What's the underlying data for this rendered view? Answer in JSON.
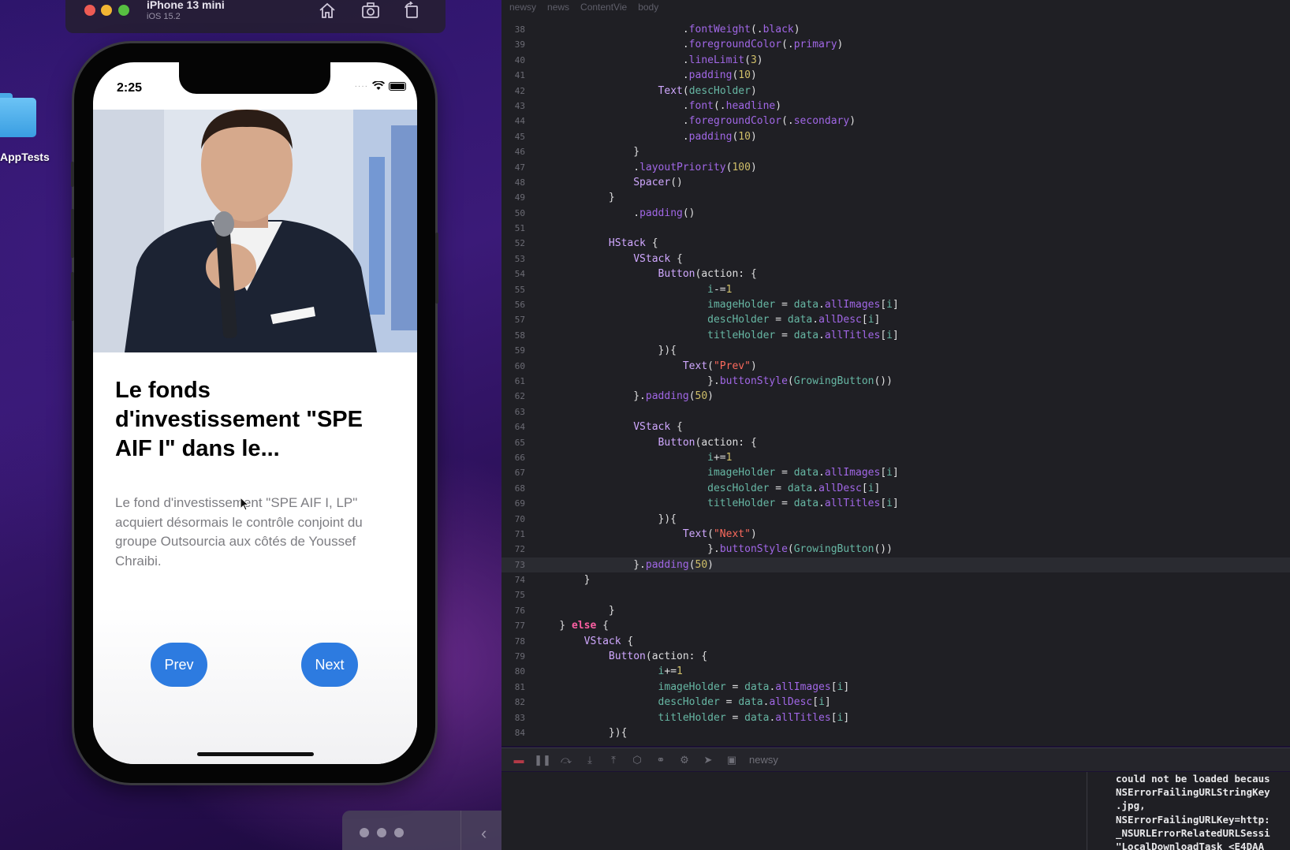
{
  "desktop": {
    "folder_label": "AppTests"
  },
  "simulator": {
    "device_name": "iPhone 13 mini",
    "os_version": "iOS 15.2"
  },
  "phone": {
    "status_time": "2:25",
    "article": {
      "title": "Le fonds d'investissement \"SPE AIF I\" dans le...",
      "description": "Le fond d'investissement \"SPE AIF I, LP\" acquiert désormais le contrôle conjoint du groupe Outsourcia aux côtés de Youssef Chraibi."
    },
    "prev_label": "Prev",
    "next_label": "Next"
  },
  "editor": {
    "breadcrumbs": [
      "newsy",
      "news",
      "ContentVie",
      "body"
    ],
    "current_line": "73",
    "lines": [
      {
        "n": "38",
        "html": "                        .<span class=\"mt\">fontWeight</span>(.<span class=\"mt\">black</span>)"
      },
      {
        "n": "39",
        "html": "                        .<span class=\"mt\">foregroundColor</span>(.<span class=\"mt\">primary</span>)"
      },
      {
        "n": "40",
        "html": "                        .<span class=\"mt\">lineLimit</span>(<span class=\"num\">3</span>)"
      },
      {
        "n": "41",
        "html": "                        .<span class=\"mt\">padding</span>(<span class=\"num\">10</span>)"
      },
      {
        "n": "42",
        "html": "                    <span class=\"ty\">Text</span>(<span class=\"fn\">descHolder</span>)"
      },
      {
        "n": "43",
        "html": "                        .<span class=\"mt\">font</span>(.<span class=\"mt\">headline</span>)"
      },
      {
        "n": "44",
        "html": "                        .<span class=\"mt\">foregroundColor</span>(.<span class=\"mt\">secondary</span>)"
      },
      {
        "n": "45",
        "html": "                        .<span class=\"mt\">padding</span>(<span class=\"num\">10</span>)"
      },
      {
        "n": "46",
        "html": "                }"
      },
      {
        "n": "47",
        "html": "                .<span class=\"mt\">layoutPriority</span>(<span class=\"num\">100</span>)"
      },
      {
        "n": "48",
        "html": "                <span class=\"ty\">Spacer</span>()"
      },
      {
        "n": "49",
        "html": "            }"
      },
      {
        "n": "50",
        "html": "                .<span class=\"mt\">padding</span>()"
      },
      {
        "n": "51",
        "html": ""
      },
      {
        "n": "52",
        "html": "            <span class=\"ty\">HStack</span> {"
      },
      {
        "n": "53",
        "html": "                <span class=\"ty\">VStack</span> {"
      },
      {
        "n": "54",
        "html": "                    <span class=\"ty\">Button</span>(action: {"
      },
      {
        "n": "55",
        "html": "                            <span class=\"fn\">i</span>-=<span class=\"num\">1</span>"
      },
      {
        "n": "56",
        "html": "                            <span class=\"fn\">imageHolder</span> = <span class=\"fn\">data</span>.<span class=\"mt\">allImages</span>[<span class=\"fn\">i</span>]"
      },
      {
        "n": "57",
        "html": "                            <span class=\"fn\">descHolder</span> = <span class=\"fn\">data</span>.<span class=\"mt\">allDesc</span>[<span class=\"fn\">i</span>]"
      },
      {
        "n": "58",
        "html": "                            <span class=\"fn\">titleHolder</span> = <span class=\"fn\">data</span>.<span class=\"mt\">allTitles</span>[<span class=\"fn\">i</span>]"
      },
      {
        "n": "59",
        "html": "                    }){"
      },
      {
        "n": "60",
        "html": "                        <span class=\"ty\">Text</span>(<span class=\"str\">\"Prev\"</span>)"
      },
      {
        "n": "61",
        "html": "                            }.<span class=\"mt\">buttonStyle</span>(<span class=\"fn\">GrowingButton</span>())"
      },
      {
        "n": "62",
        "html": "                }.<span class=\"mt\">padding</span>(<span class=\"num\">50</span>)"
      },
      {
        "n": "63",
        "html": ""
      },
      {
        "n": "64",
        "html": "                <span class=\"ty\">VStack</span> {"
      },
      {
        "n": "65",
        "html": "                    <span class=\"ty\">Button</span>(action: {"
      },
      {
        "n": "66",
        "html": "                            <span class=\"fn\">i</span>+=<span class=\"num\">1</span>"
      },
      {
        "n": "67",
        "html": "                            <span class=\"fn\">imageHolder</span> = <span class=\"fn\">data</span>.<span class=\"mt\">allImages</span>[<span class=\"fn\">i</span>]"
      },
      {
        "n": "68",
        "html": "                            <span class=\"fn\">descHolder</span> = <span class=\"fn\">data</span>.<span class=\"mt\">allDesc</span>[<span class=\"fn\">i</span>]"
      },
      {
        "n": "69",
        "html": "                            <span class=\"fn\">titleHolder</span> = <span class=\"fn\">data</span>.<span class=\"mt\">allTitles</span>[<span class=\"fn\">i</span>]"
      },
      {
        "n": "70",
        "html": "                    }){"
      },
      {
        "n": "71",
        "html": "                        <span class=\"ty\">Text</span>(<span class=\"str\">\"Next\"</span>)"
      },
      {
        "n": "72",
        "html": "                            }.<span class=\"mt\">buttonStyle</span>(<span class=\"fn\">GrowingButton</span>())"
      },
      {
        "n": "73",
        "html": "                }.<span class=\"mt\">padding</span>(<span class=\"num\">50</span>)"
      },
      {
        "n": "74",
        "html": "        }"
      },
      {
        "n": "75",
        "html": ""
      },
      {
        "n": "76",
        "html": "            }"
      },
      {
        "n": "77",
        "html": "    } <span class=\"kw\">else</span> {"
      },
      {
        "n": "78",
        "html": "        <span class=\"ty\">VStack</span> {"
      },
      {
        "n": "79",
        "html": "            <span class=\"ty\">Button</span>(action: {"
      },
      {
        "n": "80",
        "html": "                    <span class=\"fn\">i</span>+=<span class=\"num\">1</span>"
      },
      {
        "n": "81",
        "html": "                    <span class=\"fn\">imageHolder</span> = <span class=\"fn\">data</span>.<span class=\"mt\">allImages</span>[<span class=\"fn\">i</span>]"
      },
      {
        "n": "82",
        "html": "                    <span class=\"fn\">descHolder</span> = <span class=\"fn\">data</span>.<span class=\"mt\">allDesc</span>[<span class=\"fn\">i</span>]"
      },
      {
        "n": "83",
        "html": "                    <span class=\"fn\">titleHolder</span> = <span class=\"fn\">data</span>.<span class=\"mt\">allTitles</span>[<span class=\"fn\">i</span>]"
      },
      {
        "n": "84",
        "html": "            }){"
      }
    ]
  },
  "debug": {
    "scheme": "newsy"
  },
  "console": {
    "lines": [
      "could not be loaded becaus",
      "NSErrorFailingURLStringKey",
      ".jpg,",
      "NSErrorFailingURLKey=http:",
      "_NSURLErrorRelatedURLSessi",
      "\"LocalDownloadTask <E4DAA"
    ]
  }
}
